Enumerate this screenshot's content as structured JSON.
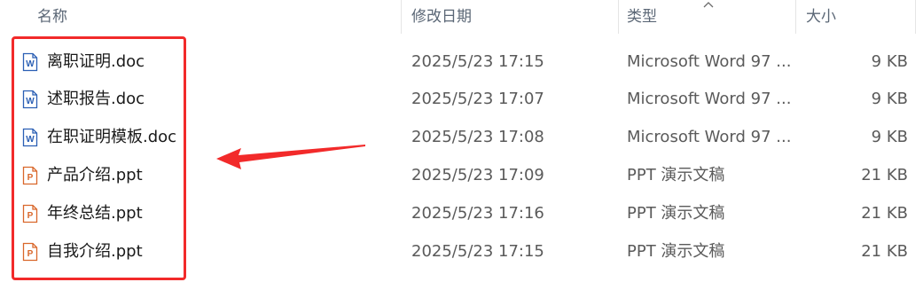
{
  "header": {
    "name": "名称",
    "date": "修改日期",
    "type": "类型",
    "size": "大小"
  },
  "files": [
    {
      "name": "离职证明.doc",
      "date": "2025/5/23 17:15",
      "type": "Microsoft Word 97 ...",
      "size": "9 KB",
      "icon": "word-doc-icon"
    },
    {
      "name": "述职报告.doc",
      "date": "2025/5/23 17:07",
      "type": "Microsoft Word 97 ...",
      "size": "9 KB",
      "icon": "word-doc-icon"
    },
    {
      "name": "在职证明模板.doc",
      "date": "2025/5/23 17:08",
      "type": "Microsoft Word 97 ...",
      "size": "9 KB",
      "icon": "word-doc-icon"
    },
    {
      "name": "产品介绍.ppt",
      "date": "2025/5/23 17:09",
      "type": "PPT 演示文稿",
      "size": "21 KB",
      "icon": "ppt-file-icon"
    },
    {
      "name": "年终总结.ppt",
      "date": "2025/5/23 17:16",
      "type": "PPT 演示文稿",
      "size": "21 KB",
      "icon": "ppt-file-icon"
    },
    {
      "name": "自我介绍.ppt",
      "date": "2025/5/23 17:15",
      "type": "PPT 演示文稿",
      "size": "21 KB",
      "icon": "ppt-file-icon"
    }
  ],
  "colors": {
    "annotation": "#f22a2a",
    "word_icon": "#2b5fb4",
    "ppt_icon": "#d9672b"
  }
}
